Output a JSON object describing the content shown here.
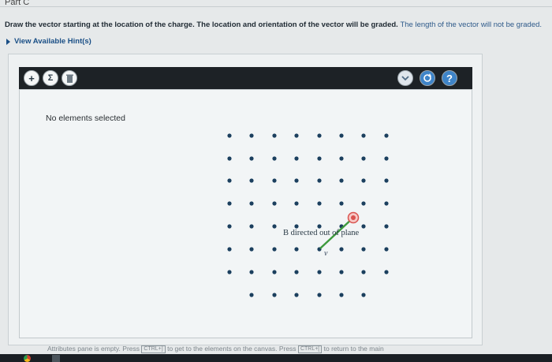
{
  "header": {
    "part_label": "Part C",
    "instruction": "Draw the vector starting at the location of the charge. The location and orientation of the vector will be graded.",
    "instruction_tail": "The length of the vector will not be graded."
  },
  "hints": {
    "label": "View Available Hint(s)"
  },
  "toolbar": {
    "add_icon": "plus-icon",
    "sigma_icon": "sigma-icon",
    "trash_icon": "trash-icon",
    "chevron_icon": "chevron-down-icon",
    "reset_icon": "reset-icon",
    "help_label": "?"
  },
  "canvas": {
    "selection_status": "No elements selected",
    "field_label": "B directed out of plane",
    "vector_label": "v",
    "colors": {
      "dot": "#1b3f5e",
      "vector": "#3d9a3d",
      "charge": "#d9534f"
    }
  },
  "status_bar": {
    "text_before": "Attributes pane is empty. Press",
    "key1": "CTRL+]",
    "text_middle": "to get to the elements on the canvas. Press",
    "key2": "CTRL+[",
    "text_after": "to return to the main"
  }
}
